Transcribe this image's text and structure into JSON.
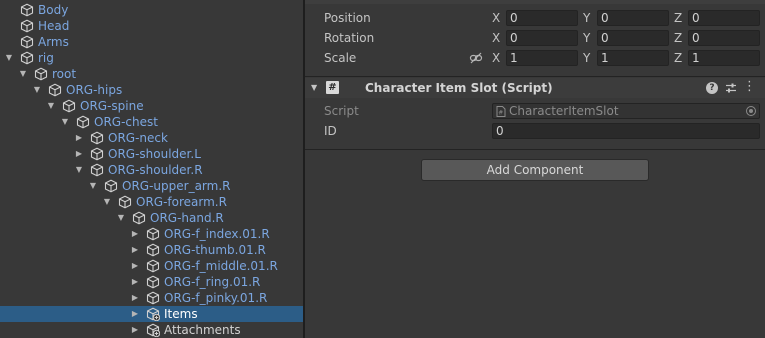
{
  "hierarchy": {
    "rows": [
      {
        "label": "Body",
        "depth": 0,
        "arrow": "",
        "selected": false,
        "linked": true,
        "icon": "gameobject-cube-icon"
      },
      {
        "label": "Head",
        "depth": 0,
        "arrow": "",
        "selected": false,
        "linked": true,
        "icon": "gameobject-cube-icon"
      },
      {
        "label": "Arms",
        "depth": 0,
        "arrow": "",
        "selected": false,
        "linked": true,
        "icon": "gameobject-cube-icon"
      },
      {
        "label": "rig",
        "depth": 0,
        "arrow": "expanded",
        "selected": false,
        "linked": true,
        "icon": "gameobject-cube-icon"
      },
      {
        "label": "root",
        "depth": 1,
        "arrow": "expanded",
        "selected": false,
        "linked": true,
        "icon": "gameobject-cube-icon"
      },
      {
        "label": "ORG-hips",
        "depth": 2,
        "arrow": "expanded",
        "selected": false,
        "linked": true,
        "icon": "gameobject-cube-icon"
      },
      {
        "label": "ORG-spine",
        "depth": 3,
        "arrow": "expanded",
        "selected": false,
        "linked": true,
        "icon": "gameobject-cube-icon"
      },
      {
        "label": "ORG-chest",
        "depth": 4,
        "arrow": "expanded",
        "selected": false,
        "linked": true,
        "icon": "gameobject-cube-icon"
      },
      {
        "label": "ORG-neck",
        "depth": 5,
        "arrow": "collapsed",
        "selected": false,
        "linked": true,
        "icon": "gameobject-cube-icon"
      },
      {
        "label": "ORG-shoulder.L",
        "depth": 5,
        "arrow": "collapsed",
        "selected": false,
        "linked": true,
        "icon": "gameobject-cube-icon"
      },
      {
        "label": "ORG-shoulder.R",
        "depth": 5,
        "arrow": "expanded",
        "selected": false,
        "linked": true,
        "icon": "gameobject-cube-icon"
      },
      {
        "label": "ORG-upper_arm.R",
        "depth": 6,
        "arrow": "expanded",
        "selected": false,
        "linked": true,
        "icon": "gameobject-cube-icon"
      },
      {
        "label": "ORG-forearm.R",
        "depth": 7,
        "arrow": "expanded",
        "selected": false,
        "linked": true,
        "icon": "gameobject-cube-icon"
      },
      {
        "label": "ORG-hand.R",
        "depth": 8,
        "arrow": "expanded",
        "selected": false,
        "linked": true,
        "icon": "gameobject-cube-icon"
      },
      {
        "label": "ORG-f_index.01.R",
        "depth": 9,
        "arrow": "collapsed",
        "selected": false,
        "linked": true,
        "icon": "gameobject-cube-icon"
      },
      {
        "label": "ORG-thumb.01.R",
        "depth": 9,
        "arrow": "collapsed",
        "selected": false,
        "linked": true,
        "icon": "gameobject-cube-icon"
      },
      {
        "label": "ORG-f_middle.01.R",
        "depth": 9,
        "arrow": "collapsed",
        "selected": false,
        "linked": true,
        "icon": "gameobject-cube-icon"
      },
      {
        "label": "ORG-f_ring.01.R",
        "depth": 9,
        "arrow": "collapsed",
        "selected": false,
        "linked": true,
        "icon": "gameobject-cube-icon"
      },
      {
        "label": "ORG-f_pinky.01.R",
        "depth": 9,
        "arrow": "collapsed",
        "selected": false,
        "linked": true,
        "icon": "gameobject-cube-icon"
      },
      {
        "label": "Items",
        "depth": 9,
        "arrow": "collapsed",
        "selected": true,
        "linked": false,
        "icon": "gameobject-added-icon"
      },
      {
        "label": "Attachments",
        "depth": 9,
        "arrow": "collapsed",
        "selected": false,
        "linked": false,
        "icon": "gameobject-added-icon"
      }
    ]
  },
  "transform": {
    "position": {
      "label": "Position",
      "x": "0",
      "y": "0",
      "z": "0"
    },
    "rotation": {
      "label": "Rotation",
      "x": "0",
      "y": "0",
      "z": "0"
    },
    "scale": {
      "label": "Scale",
      "x": "1",
      "y": "1",
      "z": "1"
    },
    "axis_labels": {
      "x": "X",
      "y": "Y",
      "z": "Z"
    }
  },
  "component": {
    "title": "Character Item Slot (Script)",
    "script_label": "Script",
    "script_value": "CharacterItemSlot",
    "id_label": "ID",
    "id_value": "0"
  },
  "add_component_label": "Add Component",
  "colors": {
    "background": "#383838",
    "selection": "#2c5d87",
    "prefab_label": "#7ba6e0"
  }
}
